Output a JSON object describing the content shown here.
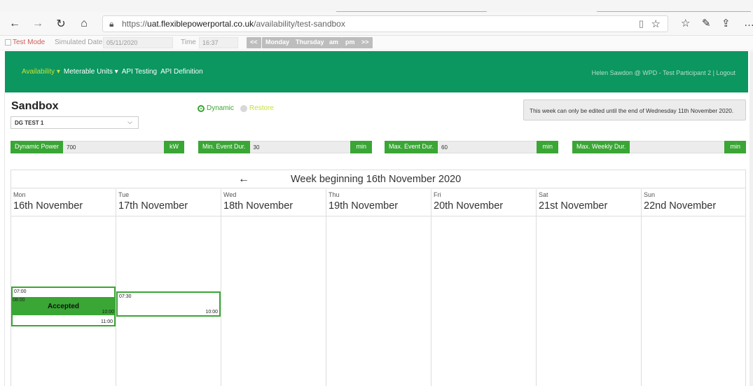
{
  "browser": {
    "url_prefix": "https://",
    "url_host": "uat.flexiblepowerportal.co.uk",
    "url_path": "/availability/test-sandbox",
    "icons": [
      "back-icon",
      "forward-icon",
      "refresh-icon",
      "home-icon",
      "lock-icon",
      "reading-view-icon",
      "star-icon",
      "favorites-icon",
      "pen-icon",
      "share-icon",
      "more-icon"
    ]
  },
  "testbar": {
    "test_mode_label": "Test Mode",
    "simulated_date_label": "Simulated Date",
    "simulated_date_value": "05/11/2020",
    "time_label": "Time",
    "time_value": "16:37",
    "buttons": [
      "<<",
      "Monday",
      "Thursday",
      "am",
      "pm",
      ">>"
    ]
  },
  "header": {
    "menu": [
      {
        "label": "Availability ▾",
        "active": true
      },
      {
        "label": "Meterable Units ▾",
        "active": false
      },
      {
        "label": "API Testing",
        "active": false
      },
      {
        "label": "API Definition",
        "active": false
      }
    ],
    "user": "Helen Sawdon @ WPD - Test Participant 2 | Logout",
    "color": "#0c9660"
  },
  "sandbox": {
    "title": "Sandbox",
    "unit_select": "DG TEST 1",
    "radio_dynamic": "Dynamic",
    "radio_restore": "Restore",
    "notice": "This week can only be edited until the end of Wednesday 11th November 2020."
  },
  "params": [
    {
      "label": "Dynamic Power",
      "value": "700",
      "unit": "kW"
    },
    {
      "label": "Min. Event Dur.",
      "value": "30",
      "unit": "min"
    },
    {
      "label": "Max. Event Dur.",
      "value": "60",
      "unit": "min"
    },
    {
      "label": "Max. Weekly Dur.",
      "value": "",
      "unit": "min"
    }
  ],
  "calendar": {
    "arrow": "←",
    "title": "Week beginning 16th November 2020",
    "days": [
      {
        "name": "Mon",
        "date": "16th November"
      },
      {
        "name": "Tue",
        "date": "17th November"
      },
      {
        "name": "Wed",
        "date": "18th November"
      },
      {
        "name": "Thu",
        "date": "19th November"
      },
      {
        "name": "Fri",
        "date": "20th November"
      },
      {
        "name": "Sat",
        "date": "21st November"
      },
      {
        "name": "Sun",
        "date": "22nd November"
      }
    ],
    "events": {
      "mon_outer_start": "07:00",
      "mon_outer_end": "11:00",
      "mon_accepted_start": "08:00",
      "mon_accepted_label": "Accepted",
      "mon_accepted_end": "10:00",
      "tue_start": "07:30",
      "tue_end": "10:00"
    },
    "accent": "#3aa635"
  }
}
